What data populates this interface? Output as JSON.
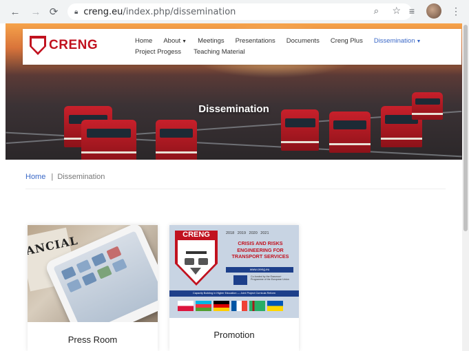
{
  "browser": {
    "url_host": "creng.eu",
    "url_path": "/index.php/dissemination"
  },
  "site": {
    "logo_text": "CRENG",
    "nav": [
      {
        "label": "Home",
        "caret": false,
        "active": false
      },
      {
        "label": "About",
        "caret": true,
        "active": false
      },
      {
        "label": "Meetings",
        "caret": false,
        "active": false
      },
      {
        "label": "Presentations",
        "caret": false,
        "active": false
      },
      {
        "label": "Documents",
        "caret": false,
        "active": false
      },
      {
        "label": "Creng Plus",
        "caret": false,
        "active": false
      },
      {
        "label": "Dissemination",
        "caret": true,
        "active": true
      },
      {
        "label": "Project Progess",
        "caret": false,
        "active": false
      },
      {
        "label": "Teaching Material",
        "caret": false,
        "active": false
      }
    ],
    "hero_title": "Dissemination"
  },
  "breadcrumb": {
    "home": "Home",
    "separator": "|",
    "current": "Dissemination"
  },
  "cards": [
    {
      "title": "Press Room",
      "image": "tablet-newspaper-image",
      "image_text": "ANCIAL"
    },
    {
      "title": "Promotion",
      "image": "creng-poster-image"
    }
  ],
  "poster": {
    "logo": "CRENG",
    "years": "2018 2019 2020 2021",
    "heading": "CRISIS AND RISKS ENGINEERING FOR TRANSPORT SERVICES",
    "url": "www.creng.eu",
    "eu_text": "Co-funded by the Erasmus+ Programme of the European Union",
    "band": "Capacity Building in Higher Education  —  Joint Project Curricula Reform",
    "flags": [
      "Poland",
      "Azerbaijan",
      "Germany",
      "France",
      "Turkmenistan",
      "Ukraine"
    ]
  },
  "colors": {
    "brand_red": "#c1121f",
    "link_blue": "#3a68c7"
  }
}
